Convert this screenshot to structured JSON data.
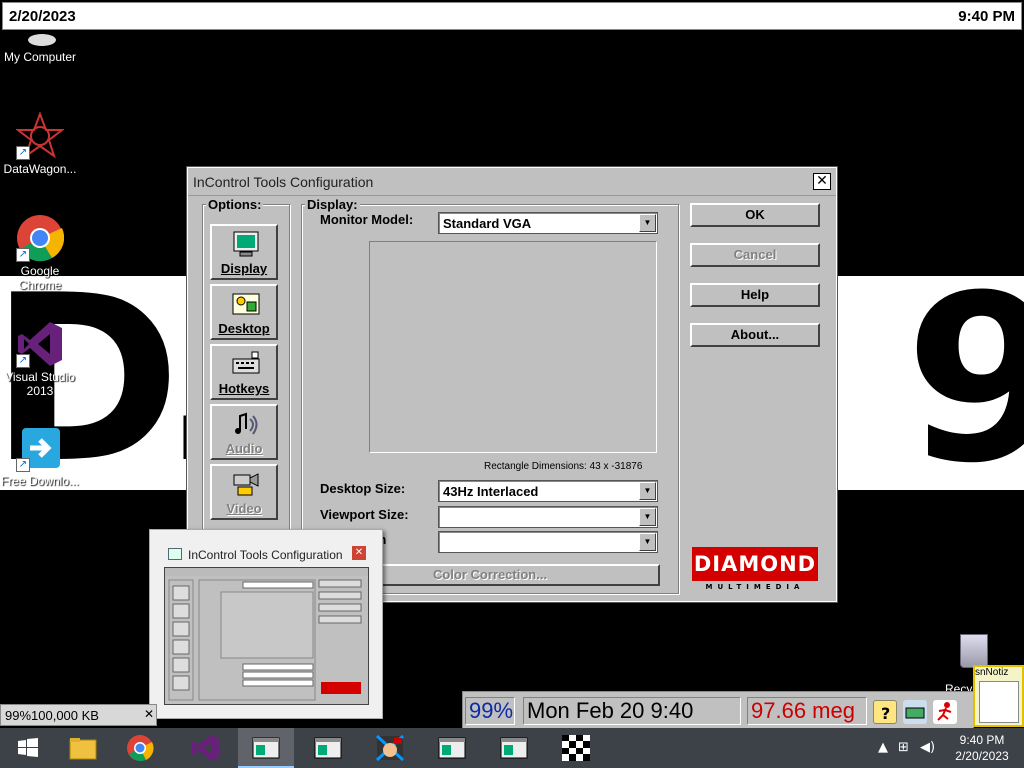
{
  "topbar": {
    "date": "2/20/2023",
    "time": "9:40 PM"
  },
  "wallpaper": {
    "glyph_left": "D",
    "glyph_left2": ".",
    "glyph_right": "9"
  },
  "desktop_icons": [
    {
      "label": "My Computer"
    },
    {
      "label": "DataWagon..."
    },
    {
      "label": "Google Chrome"
    },
    {
      "label": "Visual Studio 2013"
    },
    {
      "label": "Free Downlo..."
    }
  ],
  "dialog": {
    "title": "InControl Tools Configuration",
    "close": "✕",
    "options_label": "Options:",
    "options": [
      {
        "label": "Display",
        "enabled": true
      },
      {
        "label": "Desktop",
        "enabled": true
      },
      {
        "label": "Hotkeys",
        "enabled": true
      },
      {
        "label": "Audio",
        "enabled": false
      },
      {
        "label": "Video",
        "enabled": false
      }
    ],
    "display_label": "Display:",
    "monitor_model_label": "Monitor Model:",
    "monitor_model_value": "Standard VGA",
    "rect_dimensions": "Rectangle Dimensions:  43 x -31876",
    "desktop_size_label": "Desktop Size:",
    "desktop_size_value": "43Hz Interlaced",
    "viewport_size_label": "Viewport Size:",
    "viewport_size_value": "",
    "color_depth_label": "th",
    "color_depth_value": "",
    "color_correction": "Color Correction...",
    "buttons": {
      "ok": "OK",
      "cancel": "Cancel",
      "help": "Help",
      "about": "About..."
    },
    "logo": {
      "name": "DIAMOND",
      "sub": "MULTIMEDIA"
    }
  },
  "thumbnail": {
    "title": "InControl Tools Configuration",
    "close": "✕"
  },
  "memwin": {
    "value": "99%100,000 KB",
    "close": "✕"
  },
  "infobar": {
    "percent": "99%",
    "datetime": "Mon Feb 20 9:40",
    "memory": "97.66 meg"
  },
  "recycle": {
    "label": "Recyc"
  },
  "note": {
    "title": "snNotiz"
  },
  "tray": {
    "time": "9:40 PM",
    "date": "2/20/2023"
  },
  "colors": {
    "accent_red": "#d40000",
    "percent_blue": "#0a2aa8",
    "memory_red": "#cc0000",
    "taskbar": "#3d4148"
  }
}
